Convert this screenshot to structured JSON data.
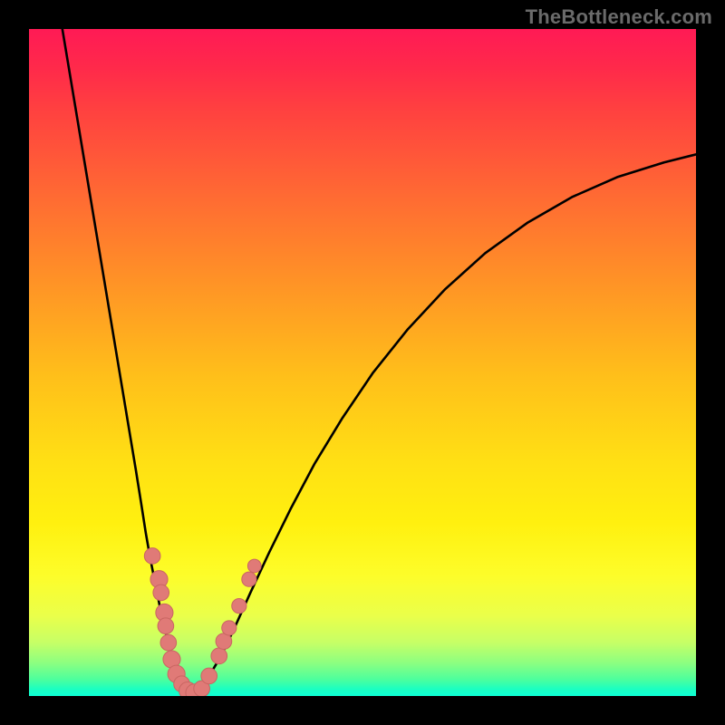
{
  "watermark": "TheBottleneck.com",
  "colors": {
    "frame": "#000000",
    "curve": "#000000",
    "dot_fill": "#e07a77",
    "dot_stroke": "#c96662"
  },
  "chart_data": {
    "type": "line",
    "title": "",
    "xlabel": "",
    "ylabel": "",
    "xlim": [
      0,
      100
    ],
    "ylim": [
      0,
      100
    ],
    "grid": false,
    "series": [
      {
        "name": "left-branch",
        "x": [
          5.0,
          6.0,
          7.0,
          8.0,
          9.0,
          10.0,
          11.0,
          12.0,
          13.0,
          14.0,
          15.0,
          16.0,
          16.8,
          17.5,
          18.2,
          19.0,
          19.7,
          20.4,
          21.1,
          21.9,
          22.6,
          23.3,
          23.8,
          24.3
        ],
        "y": [
          100,
          94,
          88,
          82,
          76,
          70,
          64,
          58,
          52,
          46,
          40,
          34,
          29,
          24.5,
          20.5,
          16.5,
          13.0,
          10.0,
          7.2,
          4.8,
          3.0,
          1.6,
          0.7,
          0.2
        ]
      },
      {
        "name": "right-branch",
        "x": [
          24.3,
          25.5,
          27.0,
          28.8,
          30.8,
          33.2,
          36.0,
          39.2,
          42.8,
          47.0,
          51.6,
          56.8,
          62.4,
          68.4,
          74.8,
          81.4,
          88.2,
          95.2,
          100.0
        ],
        "y": [
          0.2,
          1.0,
          3.0,
          6.0,
          10.2,
          15.5,
          21.5,
          28.0,
          34.8,
          41.7,
          48.5,
          55.0,
          61.0,
          66.4,
          71.0,
          74.8,
          77.8,
          80.0,
          81.2
        ]
      }
    ],
    "dots": [
      {
        "x": 18.5,
        "y": 21.0,
        "r": 1.2
      },
      {
        "x": 19.5,
        "y": 17.5,
        "r": 1.3
      },
      {
        "x": 19.8,
        "y": 15.5,
        "r": 1.2
      },
      {
        "x": 20.3,
        "y": 12.5,
        "r": 1.3
      },
      {
        "x": 20.5,
        "y": 10.5,
        "r": 1.2
      },
      {
        "x": 20.9,
        "y": 8.0,
        "r": 1.2
      },
      {
        "x": 21.4,
        "y": 5.5,
        "r": 1.3
      },
      {
        "x": 22.1,
        "y": 3.3,
        "r": 1.3
      },
      {
        "x": 22.9,
        "y": 1.8,
        "r": 1.2
      },
      {
        "x": 23.8,
        "y": 0.8,
        "r": 1.3
      },
      {
        "x": 24.8,
        "y": 0.5,
        "r": 1.3
      },
      {
        "x": 25.9,
        "y": 1.1,
        "r": 1.2
      },
      {
        "x": 27.0,
        "y": 3.0,
        "r": 1.2
      },
      {
        "x": 28.5,
        "y": 6.0,
        "r": 1.2
      },
      {
        "x": 29.2,
        "y": 8.2,
        "r": 1.2
      },
      {
        "x": 30.0,
        "y": 10.2,
        "r": 1.1
      },
      {
        "x": 31.5,
        "y": 13.5,
        "r": 1.1
      },
      {
        "x": 33.0,
        "y": 17.5,
        "r": 1.1
      },
      {
        "x": 33.8,
        "y": 19.5,
        "r": 1.0
      }
    ]
  }
}
